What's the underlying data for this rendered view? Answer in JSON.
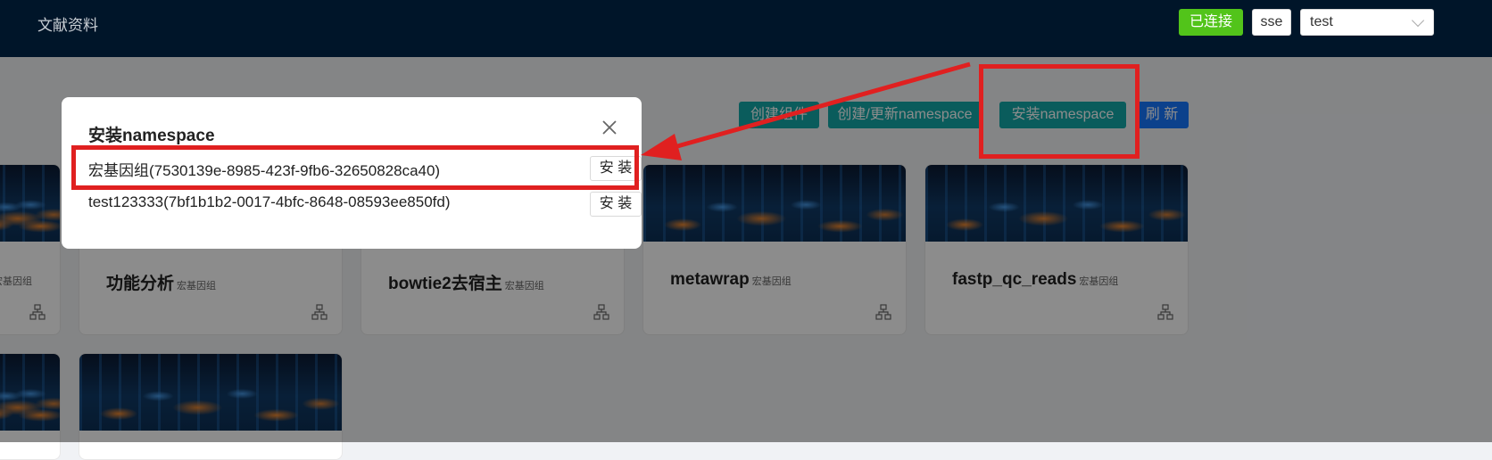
{
  "header": {
    "nav_edge": "：",
    "nav_docs": "文献资料",
    "status_badge": "已连接",
    "sse_label": "sse",
    "env_select_value": "test"
  },
  "toolbar": {
    "create_component": "创建组件",
    "create_update_namespace": "创建/更新namespace",
    "install_namespace": "安装namespace",
    "refresh": "刷 新"
  },
  "colors": {
    "topbar": "#001529",
    "connected": "#52c41a",
    "teal": "#13a8a8",
    "blue": "#1677ff",
    "highlight": "#e02020"
  },
  "cards": [
    {
      "title": "",
      "tag": "宏基因组"
    },
    {
      "title": "功能分析",
      "tag": "宏基因组"
    },
    {
      "title": "bowtie2去宿主",
      "tag": "宏基因组"
    },
    {
      "title": "metawrap",
      "tag": "宏基因组"
    },
    {
      "title": "fastp_qc_reads",
      "tag": "宏基因组"
    }
  ],
  "modal": {
    "title": "安装namespace",
    "rows": [
      {
        "label": "宏基因组(7530139e-8985-423f-9fb6-32650828ca40)",
        "button": "安 装"
      },
      {
        "label": "test123333(7bf1b1b2-0017-4bfc-8648-08593ee850fd)",
        "button": "安 装"
      }
    ]
  }
}
